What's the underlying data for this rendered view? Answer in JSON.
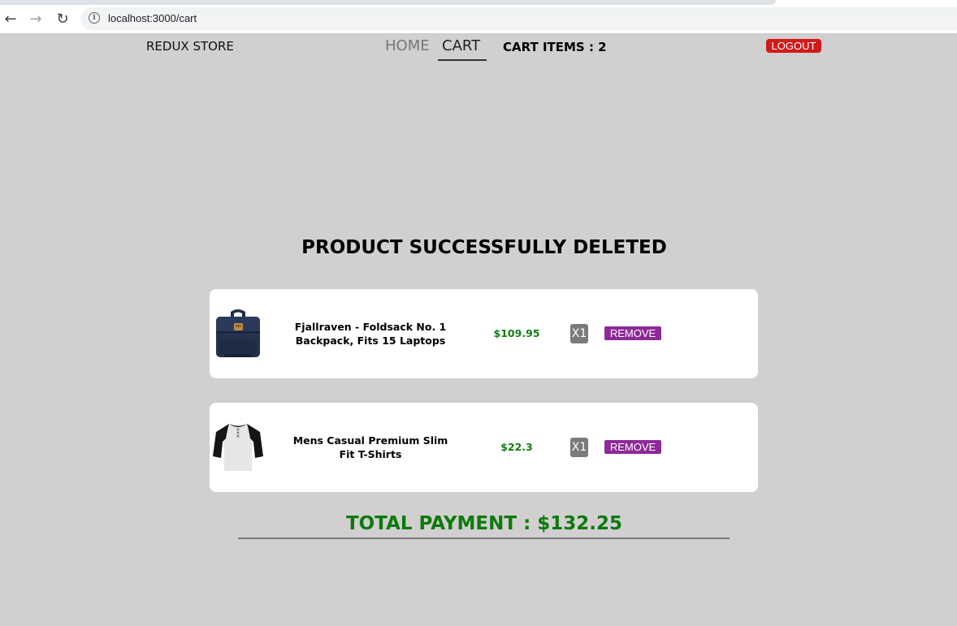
{
  "browser": {
    "url": "localhost:3000/cart",
    "back_icon": "←",
    "forward_icon": "→",
    "reload_icon": "↻",
    "info_icon": "i"
  },
  "header": {
    "brand": "REDUX STORE",
    "nav": {
      "home": "HOME",
      "cart": "CART"
    },
    "cart_items": "CART ITEMS : 2",
    "logout": "LOGOUT"
  },
  "main": {
    "status_message": "PRODUCT SUCCESSFULLY DELETED",
    "items": [
      {
        "image": "backpack-icon",
        "title": "Fjallraven - Foldsack No. 1 Backpack, Fits 15 Laptops",
        "price": "$109.95",
        "quantity": "X1",
        "remove_label": "REMOVE"
      },
      {
        "image": "tshirt-icon",
        "title": "Mens Casual Premium Slim Fit T-Shirts",
        "price": "$22.3",
        "quantity": "X1",
        "remove_label": "REMOVE"
      }
    ],
    "total": "TOTAL PAYMENT : $132.25"
  },
  "colors": {
    "page_bg": "#d1cfd0",
    "price_green": "#137c13",
    "total_green": "#0b7a0b",
    "logout_red": "#d11a1a",
    "remove_purple": "#8e2a97",
    "qty_gray": "#7b7b7b"
  }
}
